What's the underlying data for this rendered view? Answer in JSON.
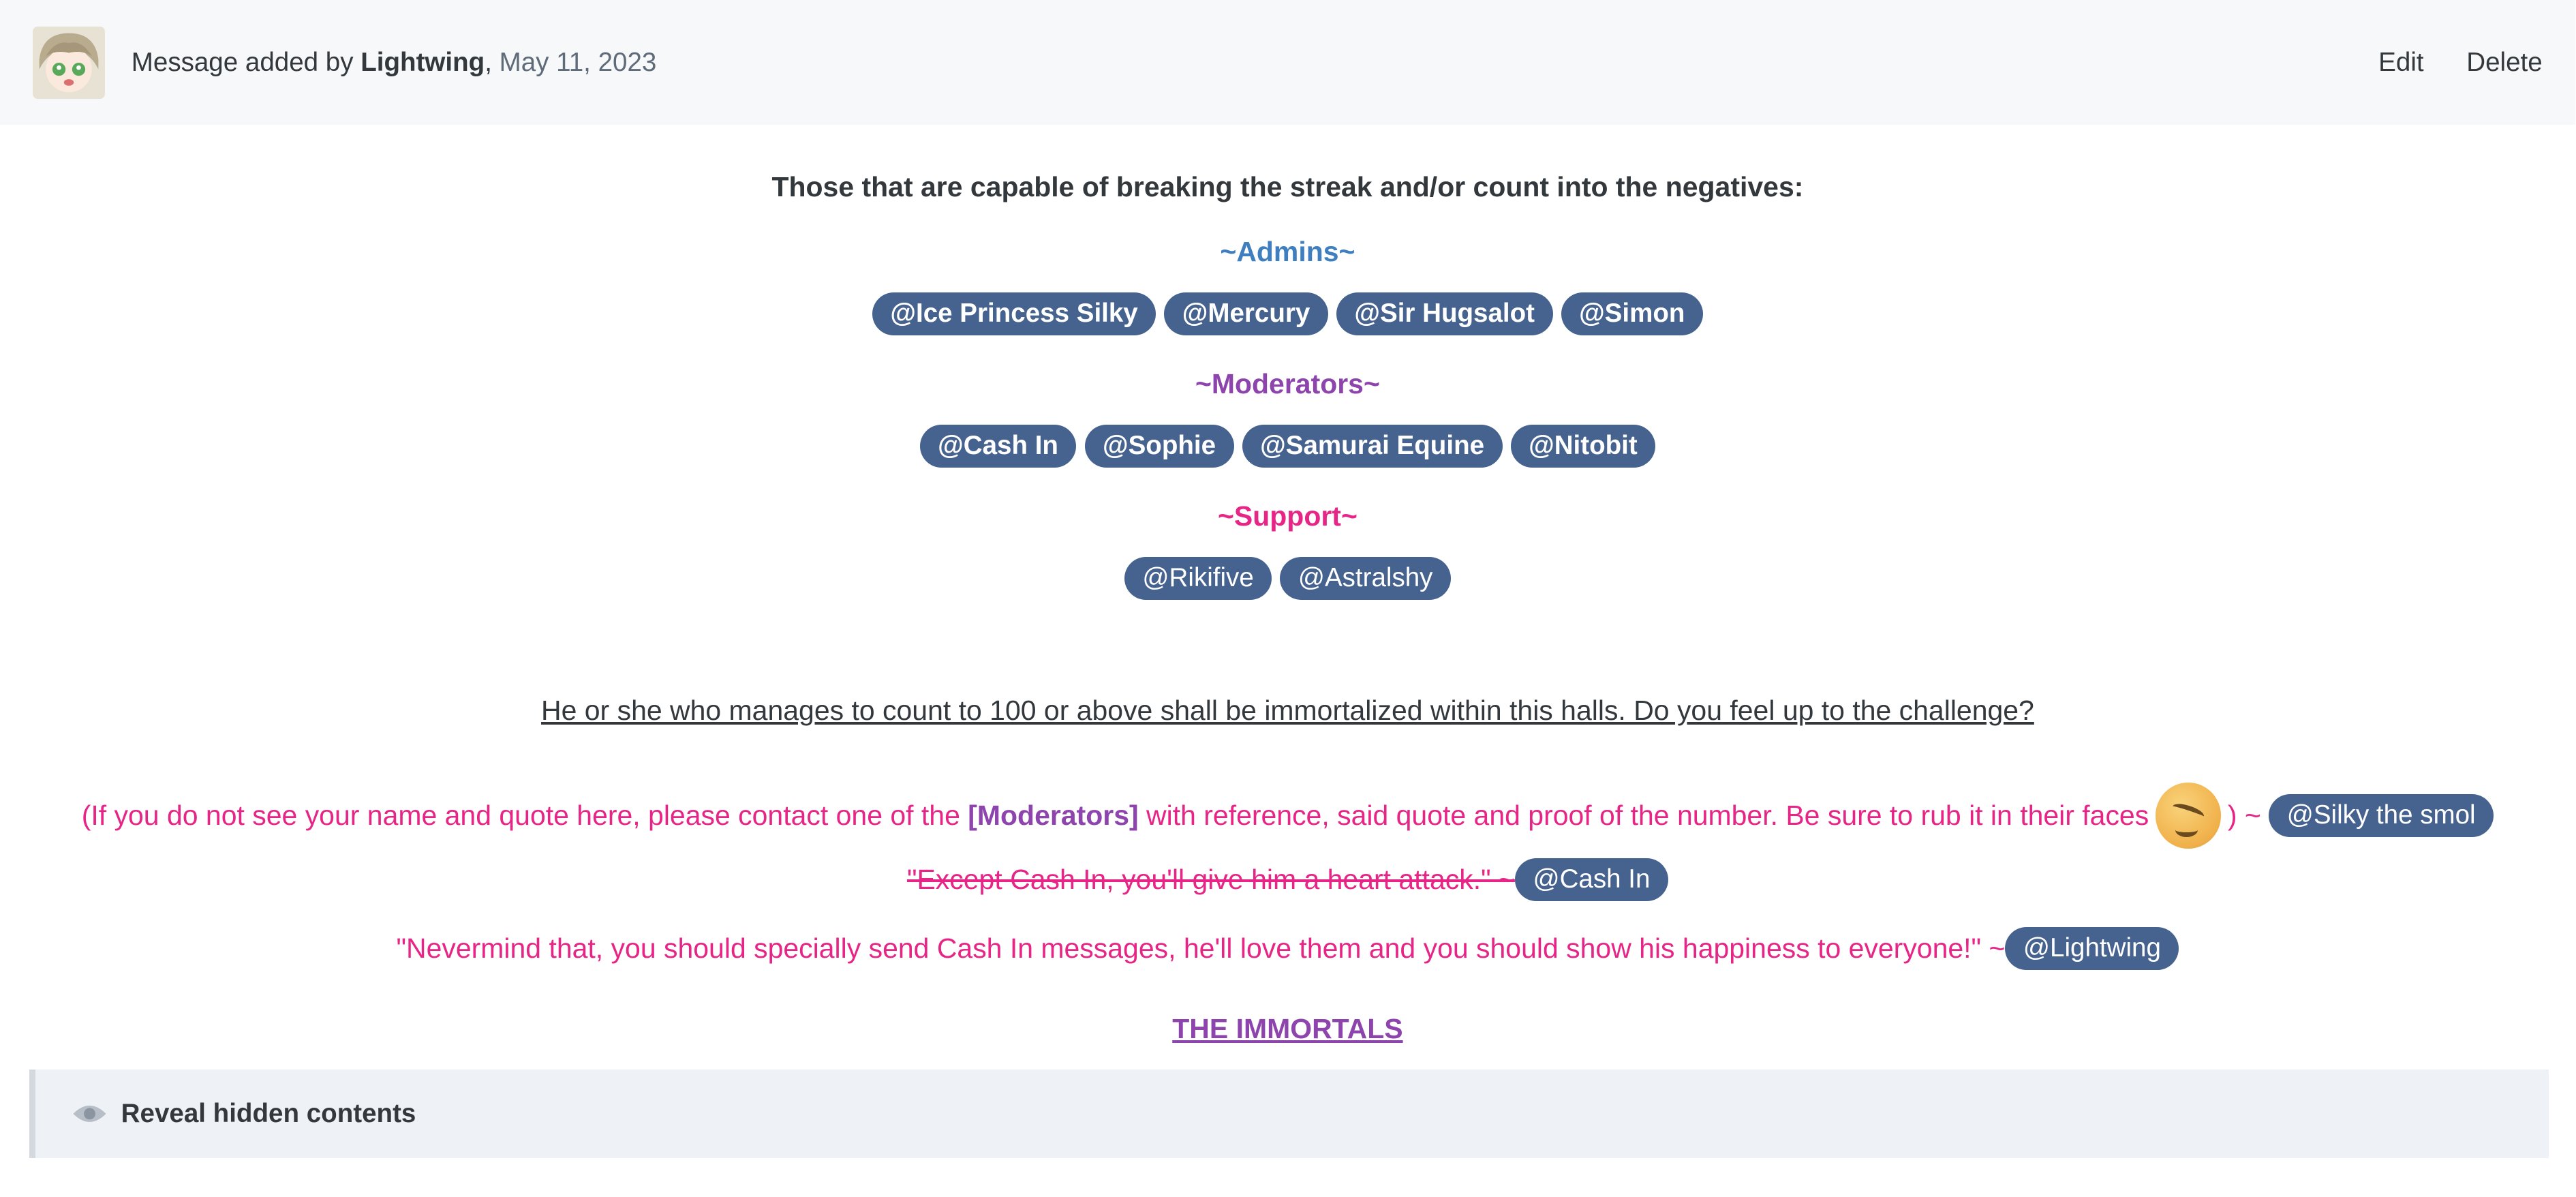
{
  "header": {
    "prefix": "Message added by ",
    "author": "Lightwing",
    "separator": ", ",
    "date": "May 11, 2023",
    "edit_label": "Edit",
    "delete_label": "Delete"
  },
  "content": {
    "heading": "Those that are capable of breaking the streak and/or count into the negatives:",
    "admins_title": "~Admins~",
    "admins": [
      "@Ice Princess Silky",
      "@Mercury",
      "@Sir Hugsalot",
      "@Simon"
    ],
    "mods_title": "~Moderators~",
    "mods": [
      "@Cash In",
      "@Sophie",
      "@Samurai Equine",
      "@Nitobit"
    ],
    "support_title": "~Support~",
    "support": [
      "@Rikifive",
      "@Astralshy"
    ],
    "challenge": "He or she who manages to count to 100 or above shall be immortalized within this halls. Do you feel up to the challenge?",
    "note_part1": "(If you do not see your name and quote here, please contact one of the ",
    "note_modref": "[Moderators]",
    "note_part2": " with reference, said quote and proof of the number. Be sure to rub it in their faces",
    "note_close": ")  ~ ",
    "note_mention": "@Silky the smol",
    "quote1": "\"Except Cash In, you'll give him a heart attack.\" ~",
    "quote1_mention": "@Cash In",
    "quote2": "\"Nevermind that, you should specially send Cash In messages, he'll love them and you should show his happiness to everyone!\" ~",
    "quote2_mention": "@Lightwing",
    "immortals": "THE IMMORTALS"
  },
  "spoiler": {
    "label": "Reveal hidden contents",
    "icon": "eye-icon"
  },
  "colors": {
    "mention_bg": "#46628f",
    "admins": "#3f7fbf",
    "mods": "#8e44ad",
    "support": "#e62587",
    "header_bg": "#f7f8fa"
  }
}
